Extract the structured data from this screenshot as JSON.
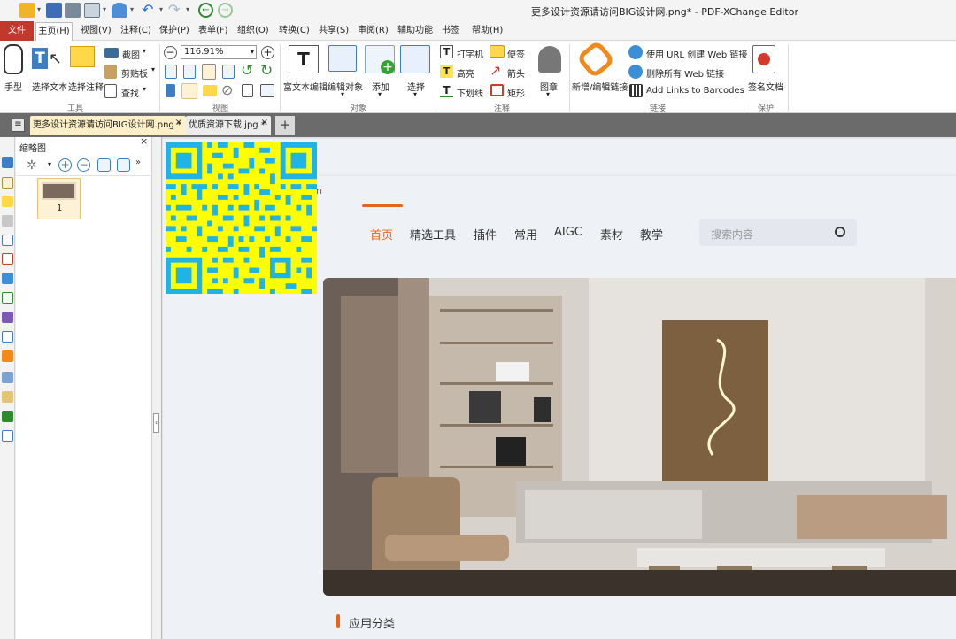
{
  "window": {
    "title": "更多设计资源请访问BIG设计网.png* - PDF-XChange Editor"
  },
  "menu": {
    "file": "文件",
    "items": [
      "主页(H)",
      "视图(V)",
      "注释(C)",
      "保护(P)",
      "表单(F)",
      "组织(O)",
      "转换(C)",
      "共享(S)",
      "审阅(R)",
      "辅助功能",
      "书签",
      "帮助(H)"
    ]
  },
  "ribbon": {
    "tools": {
      "hand": "手型",
      "select_text": "选择文本",
      "select_annot": "选择注释",
      "screenshot": "截图",
      "clipboard": "剪贴板",
      "find": "查找",
      "group": "工具"
    },
    "view": {
      "zoom": "116.91%",
      "group": "视图"
    },
    "objects": {
      "rich_text": "富文本编辑",
      "edit_object": "编辑对象",
      "add": "添加",
      "select": "选择",
      "group": "对象"
    },
    "annotations": {
      "typewriter": "打字机",
      "note": "便签",
      "highlight": "高亮",
      "arrow": "箭头",
      "underline": "下划线",
      "rectangle": "矩形",
      "stamp": "图章",
      "group": "注释"
    },
    "links": {
      "add_edit": "新增/编辑链接",
      "create_url": "使用 URL 创建 Web 链接",
      "remove_all": "删除所有 Web 链接",
      "barcodes": "Add Links to Barcodes",
      "group": "链接"
    },
    "protect": {
      "sign": "签名文档",
      "group": "保护"
    }
  },
  "tabs": [
    {
      "label": "更多设计资源请访问BIG设计网.png *",
      "active": true
    },
    {
      "label": "优质资源下载.jpg *",
      "active": false
    }
  ],
  "thumbnails": {
    "title": "缩略图",
    "page_number": "1"
  },
  "website": {
    "partial_char": "n",
    "nav": [
      "首页",
      "精选工具",
      "插件",
      "常用",
      "AIGC",
      "素材",
      "教学"
    ],
    "search_placeholder": "搜索内容",
    "section_title": "应用分类"
  },
  "colors": {
    "accent": "#e8631a",
    "file_menu": "#c0392b",
    "qr_fg": "#1fb3e6",
    "qr_bg": "#ffff00"
  }
}
